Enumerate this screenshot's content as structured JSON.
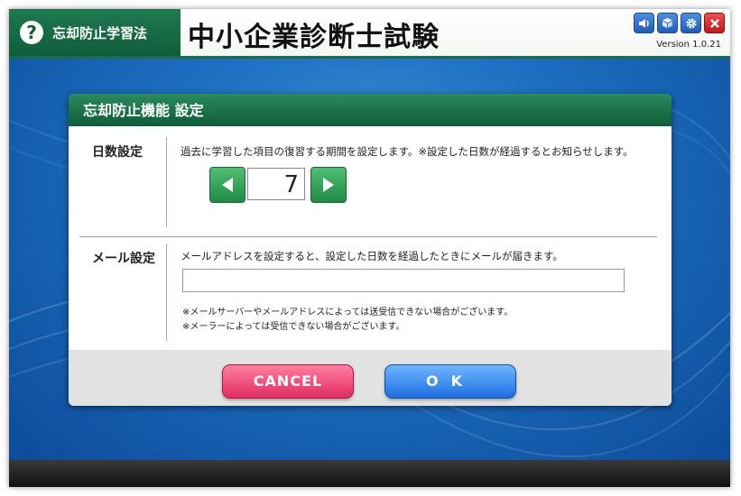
{
  "header": {
    "badge_icon": "question-icon",
    "badge_symbol": "?",
    "badge_label": "忘却防止学習法",
    "app_title": "中小企業診断士試験",
    "version": "Version 1.0.21",
    "icons": [
      "sound-icon",
      "cube-icon",
      "gear-icon",
      "close-icon"
    ]
  },
  "dialog": {
    "title": "忘却防止機能 設定",
    "days": {
      "label": "日数設定",
      "description": "過去に学習した項目の復習する期間を設定します。※設定した日数が経過するとお知らせします。",
      "value": "7"
    },
    "mail": {
      "label": "メール設定",
      "description": "メールアドレスを設定すると、設定した日数を経過したときにメールが届きます。",
      "input_value": "",
      "note1": "※メールサーバーやメールアドレスによっては送受信できない場合がございます。",
      "note2": "※メーラーによっては受信できない場合がございます。"
    },
    "cancel_label": "CANCEL",
    "ok_label": "OK"
  },
  "colors": {
    "header_green": "#0f5c39",
    "cancel_pink": "#e02c62",
    "ok_blue": "#1d6fe0",
    "arrow_green": "#1f8a45",
    "background_blue": "#1e6fc0"
  }
}
